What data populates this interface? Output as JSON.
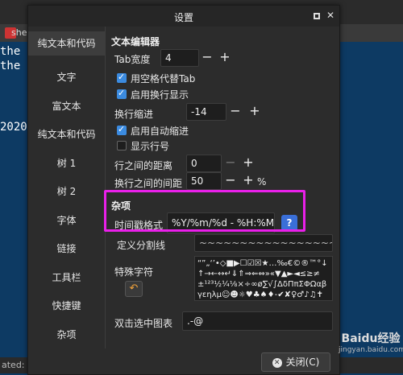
{
  "background": {
    "tab_label": "shel",
    "lines": [
      "the fi",
      "the s",
      "2020"
    ],
    "status_text": "ated: 2"
  },
  "dialog": {
    "title": "设置",
    "close_button": "关闭(C)"
  },
  "sidebar": {
    "items": [
      {
        "label": "纯文本和代码",
        "active": true
      },
      {
        "label": "文字"
      },
      {
        "label": "富文本"
      },
      {
        "label": "纯文本和代码"
      },
      {
        "label": "树 1"
      },
      {
        "label": "树 2"
      },
      {
        "label": "字体"
      },
      {
        "label": "链接"
      },
      {
        "label": "工具栏"
      },
      {
        "label": "快捷键"
      },
      {
        "label": "杂项"
      }
    ]
  },
  "editor": {
    "section_title": "文本编辑器",
    "tab_width_label": "Tab宽度",
    "tab_width_value": "4",
    "use_spaces_label": "用空格代替Tab",
    "use_spaces_checked": true,
    "wrap_label": "启用换行显示",
    "wrap_checked": true,
    "wrap_indent_label": "换行缩进",
    "wrap_indent_value": "-14",
    "auto_indent_label": "启用自动缩进",
    "auto_indent_checked": true,
    "line_numbers_label": "显示行号",
    "line_numbers_checked": false,
    "line_spacing_label": "行之间的距离",
    "line_spacing_value": "0",
    "wrap_spacing_label": "换行之间的间距",
    "wrap_spacing_value": "50",
    "wrap_spacing_unit": "%"
  },
  "misc": {
    "section_title": "杂项",
    "timestamp_label": "时间戳格式",
    "timestamp_value": "%Y/%m/%d - %H:%M",
    "help_button": "?",
    "divider_label": "定义分割线",
    "divider_value": "~~~~~~~~~~~~~~~~~~~~~~~~~~~~~~",
    "special_chars_label": "特殊字符",
    "special_chars_value": "“”„‘’•◇■▶☐☑☒★…‰€©®™°↓↑→←↔↵⇓⇑⇒⇐⇔»«▼▲►◄≤≥≠±¹²³½¼⅛×÷∞ø∑√∫ΔδΠπΣΦΩαβγεηλμ☺☻☼♥♣♠♦-✔✘♀♂♪♫✝",
    "double_click_label": "双击选中图表",
    "double_click_value": ".-@"
  },
  "watermark": {
    "text": "Baidu经验",
    "sub": "jingyan.baidu.com"
  },
  "colors": {
    "accent": "#3b8be0",
    "highlight": "#ea20ea",
    "background": "#0d3a63"
  }
}
